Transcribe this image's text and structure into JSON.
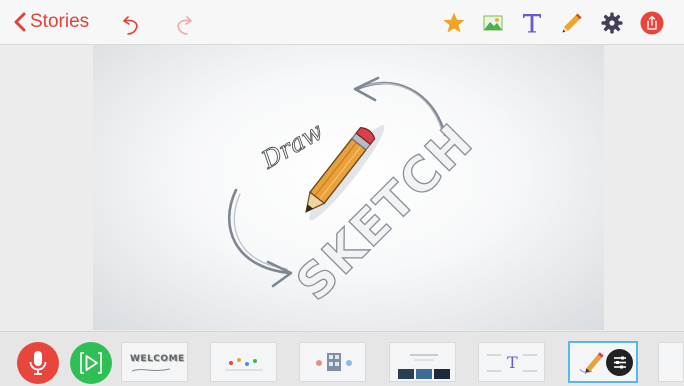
{
  "toolbar": {
    "back_label": "Stories",
    "accent_color": "#e04336",
    "icons": [
      "undo-icon",
      "redo-icon",
      "star-icon",
      "image-icon",
      "text-icon",
      "pencil-icon",
      "gear-icon",
      "share-icon"
    ]
  },
  "canvas": {
    "slide_texts": {
      "draw": "Draw",
      "sketch": "SKETCH"
    }
  },
  "strip": {
    "buttons": [
      "mic-icon",
      "play-icon"
    ],
    "thumbnails": [
      {
        "label": "WELCOME",
        "active": false
      },
      {
        "label": "",
        "active": false
      },
      {
        "label": "",
        "active": false
      },
      {
        "label": "",
        "active": false
      },
      {
        "label": "T",
        "active": false
      },
      {
        "label": "",
        "active": true
      },
      {
        "label": "",
        "active": false
      }
    ],
    "active_color": "#52b9e8"
  }
}
